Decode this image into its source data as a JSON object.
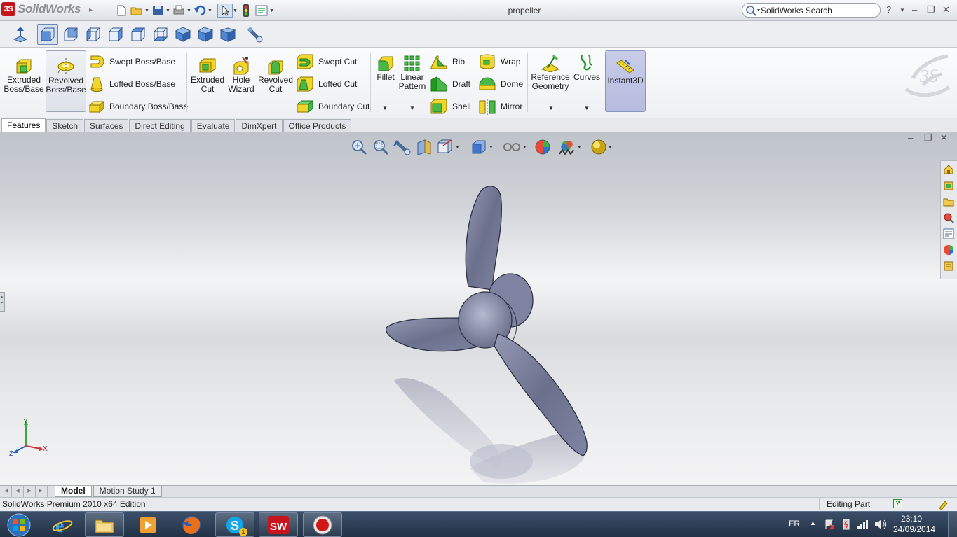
{
  "app": {
    "name": "SolidWorks",
    "document_title": "propeller"
  },
  "search": {
    "placeholder": "SolidWorks Search"
  },
  "command_manager": {
    "extruded_boss": "Extruded\nBoss/Base",
    "revolved_boss": "Revolved\nBoss/Base",
    "swept_boss": "Swept Boss/Base",
    "lofted_boss": "Lofted Boss/Base",
    "boundary_boss": "Boundary Boss/Base",
    "extruded_cut": "Extruded\nCut",
    "hole_wizard": "Hole\nWizard",
    "revolved_cut": "Revolved\nCut",
    "swept_cut": "Swept Cut",
    "lofted_cut": "Lofted Cut",
    "boundary_cut": "Boundary Cut",
    "fillet": "Fillet",
    "linear_pattern": "Linear\nPattern",
    "rib": "Rib",
    "draft": "Draft",
    "shell": "Shell",
    "wrap": "Wrap",
    "dome": "Dome",
    "mirror": "Mirror",
    "reference_geometry": "Reference\nGeometry",
    "curves": "Curves",
    "instant3d": "Instant3D"
  },
  "tabs": [
    "Features",
    "Sketch",
    "Surfaces",
    "Direct Editing",
    "Evaluate",
    "DimXpert",
    "Office Products"
  ],
  "bottom_tabs": [
    "Model",
    "Motion Study 1"
  ],
  "status": {
    "edition": "SolidWorks Premium 2010 x64 Edition",
    "mode": "Editing Part"
  },
  "triad": {
    "x": "X",
    "y": "Y",
    "z": "Z"
  },
  "taskbar": {
    "language": "FR",
    "time": "23:10",
    "date": "24/09/2014",
    "skype_badge": "1"
  },
  "colors": {
    "model": "#6e7390",
    "accent_blue": "#2a78c8",
    "feature_yellow": "#e8d21e",
    "feature_green": "#3fb53f"
  }
}
